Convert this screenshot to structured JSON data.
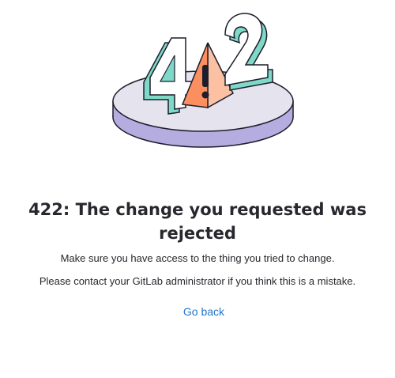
{
  "illustration": {
    "digits": [
      "4",
      "2"
    ],
    "warning_glyph": "!",
    "colors": {
      "platform_top": "#e4e3ee",
      "platform_side": "#b5ace0",
      "outline": "#1d1d2b",
      "digit_fill": "#ffffff",
      "digit_side": "#7ed9c8",
      "warning_front": "#fb8f5f",
      "warning_side": "#fcc0a2"
    }
  },
  "error": {
    "title": "422: The change you requested was rejected",
    "message": "Make sure you have access to the thing you tried to change.",
    "contact": "Please contact your GitLab administrator if you think this is a mistake.",
    "go_back_label": "Go back"
  },
  "colors": {
    "title_text": "#28272d",
    "link": "#1f75cb"
  }
}
